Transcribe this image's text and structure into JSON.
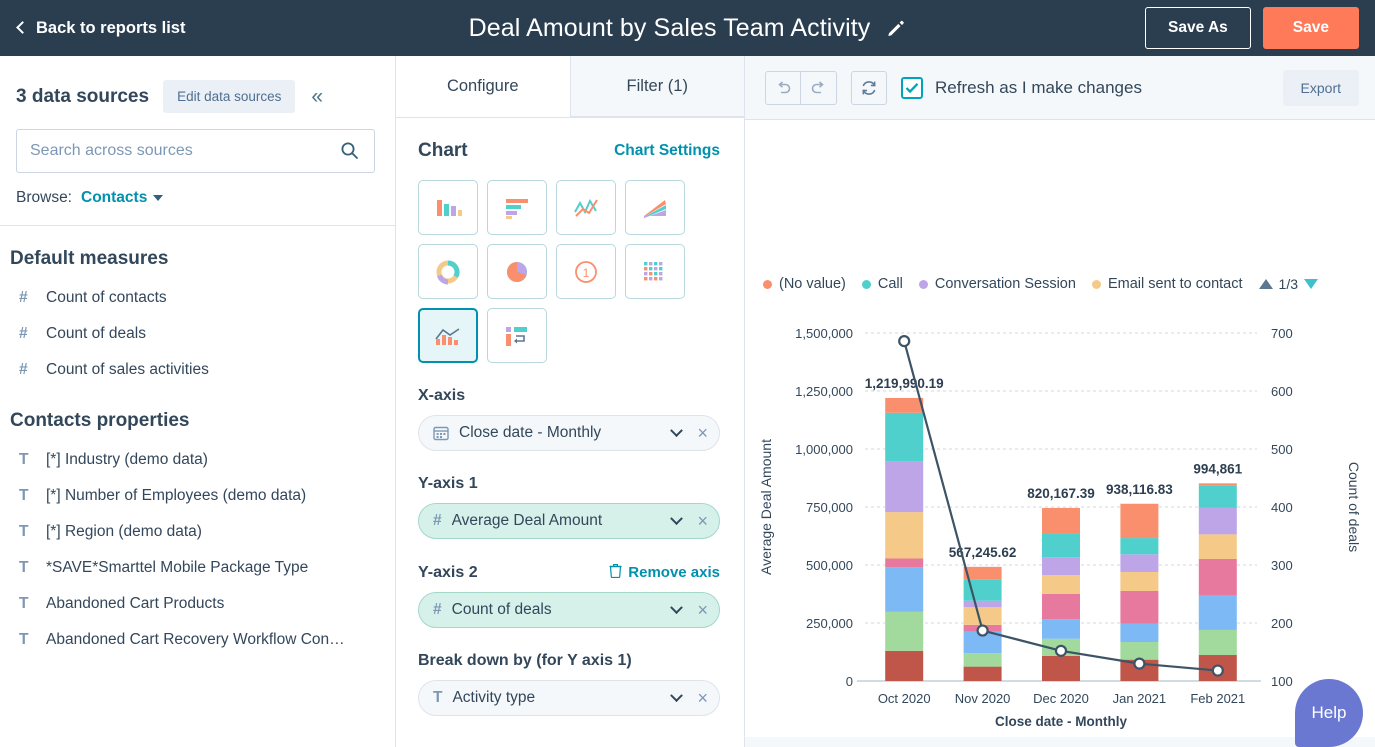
{
  "topbar": {
    "back_label": "Back to reports list",
    "title": "Deal Amount by Sales Team Activity",
    "edit_icon": "pencil-icon",
    "save_as_label": "Save As",
    "save_label": "Save",
    "save_color": "#ff7a59",
    "bg_color": "#2a3e50"
  },
  "sidebar": {
    "sources_count_label": "3 data sources",
    "edit_sources_label": "Edit data sources",
    "collapse_icon": "collapse-left-icon",
    "search_placeholder": "Search across sources",
    "search_value": "",
    "browse_label": "Browse:",
    "browse_value": "Contacts",
    "sections": [
      {
        "title": "Default measures",
        "items": [
          {
            "type": "#",
            "label": "Count of contacts"
          },
          {
            "type": "#",
            "label": "Count of deals"
          },
          {
            "type": "#",
            "label": "Count of sales activities"
          }
        ]
      },
      {
        "title": "Contacts properties",
        "items": [
          {
            "type": "T",
            "label": "[*] Industry (demo data)"
          },
          {
            "type": "T",
            "label": "[*] Number of Employees (demo data)"
          },
          {
            "type": "T",
            "label": "[*] Region (demo data)"
          },
          {
            "type": "T",
            "label": "*SAVE*Smarttel Mobile Package Type"
          },
          {
            "type": "T",
            "label": "Abandoned Cart Products"
          },
          {
            "type": "T",
            "label": "Abandoned Cart Recovery Workflow Con…"
          }
        ]
      }
    ]
  },
  "configure": {
    "tabs": [
      {
        "label": "Configure",
        "active": true
      },
      {
        "label": "Filter (1)",
        "active": false
      }
    ],
    "chart_section_title": "Chart",
    "chart_settings_label": "Chart Settings",
    "chart_types": [
      {
        "name": "vertical-bar-chart-icon",
        "selected": false
      },
      {
        "name": "horizontal-bar-chart-icon",
        "selected": false
      },
      {
        "name": "line-chart-icon",
        "selected": false
      },
      {
        "name": "area-chart-icon",
        "selected": false
      },
      {
        "name": "donut-chart-icon",
        "selected": false
      },
      {
        "name": "pie-chart-icon",
        "selected": false
      },
      {
        "name": "single-value-chart-icon",
        "selected": false
      },
      {
        "name": "pivot-table-icon",
        "selected": false
      },
      {
        "name": "combo-chart-icon",
        "selected": true
      },
      {
        "name": "funnel-chart-icon",
        "selected": false
      }
    ],
    "x_axis": {
      "label": "X-axis",
      "value": "Close date - Monthly",
      "icon": "calendar-icon"
    },
    "y_axis_1": {
      "label": "Y-axis 1",
      "value": "Average Deal Amount",
      "icon": "#"
    },
    "y_axis_2": {
      "label": "Y-axis 2",
      "value": "Count of deals",
      "icon": "#",
      "remove_label": "Remove axis",
      "remove_icon": "trash-icon"
    },
    "breakdown": {
      "label": "Break down by (for Y axis 1)",
      "value": "Activity type",
      "icon": "T"
    }
  },
  "chart_toolbar": {
    "undo_icon": "undo-icon",
    "redo_icon": "redo-icon",
    "refresh_icon": "refresh-icon",
    "refresh_checkbox_checked": true,
    "refresh_label": "Refresh as I make changes",
    "export_label": "Export"
  },
  "help": {
    "label": "Help",
    "color": "#6a78d1"
  },
  "chart_data": {
    "type": "bar",
    "title": "",
    "xlabel": "Close date - Monthly",
    "ylabel": "Average Deal Amount",
    "y2label": "Count of deals",
    "categories": [
      "Oct 2020",
      "Nov 2020",
      "Dec 2020",
      "Jan 2021",
      "Feb 2021"
    ],
    "ylim": [
      0,
      1500000
    ],
    "yticks": [
      0,
      250000,
      500000,
      750000,
      1000000,
      1250000,
      1500000
    ],
    "yticklabels": [
      "0",
      "250,000",
      "500,000",
      "750,000",
      "1,000,000",
      "1,250,000",
      "1,500,000"
    ],
    "y2lim": [
      100,
      700
    ],
    "y2ticks": [
      100,
      200,
      300,
      400,
      500,
      600,
      700
    ],
    "y2ticklabels": [
      "100",
      "200",
      "300",
      "400",
      "500",
      "600",
      "700"
    ],
    "grid": true,
    "bar_totals": [
      1219990.19,
      567245.62,
      820167.39,
      938116.83,
      994861
    ],
    "bar_total_labels": [
      "1,219,990.19",
      "567,245.62",
      "820,167.39",
      "938,116.83",
      "994,861"
    ],
    "stack_order_bottom_to_top": [
      "brick",
      "green",
      "blue",
      "pink",
      "orange",
      "purple",
      "teal",
      "salmon"
    ],
    "stack_colors": {
      "brick": "#c0564a",
      "green": "#a2d99c",
      "blue": "#7cb9f5",
      "pink": "#e8799e",
      "orange": "#f5c987",
      "purple": "#bda5e8",
      "teal": "#4fd0cd",
      "salmon": "#fa8f6e"
    },
    "stacked_series": [
      {
        "name": "brick",
        "values": [
          130000,
          62000,
          108000,
          92000,
          112000
        ]
      },
      {
        "name": "green",
        "values": [
          168000,
          58000,
          74000,
          76000,
          108000
        ]
      },
      {
        "name": "blue",
        "values": [
          192000,
          92000,
          84000,
          80000,
          148000
        ]
      },
      {
        "name": "pink",
        "values": [
          38000,
          30000,
          110000,
          140000,
          158000
        ]
      },
      {
        "name": "orange",
        "values": [
          200000,
          76000,
          80000,
          82000,
          106000
        ]
      },
      {
        "name": "purple",
        "values": [
          220000,
          28000,
          78000,
          76000,
          114000
        ]
      },
      {
        "name": "teal",
        "values": [
          208000,
          90000,
          102000,
          70000,
          96000
        ]
      },
      {
        "name": "salmon",
        "values": [
          64000,
          56000,
          110000,
          148000,
          10000
        ]
      }
    ],
    "line_series": {
      "name": "Count of deals",
      "color": "#3d5466",
      "values": [
        686,
        187,
        152,
        130,
        118
      ],
      "marker": "circle-open"
    },
    "legend": {
      "position": "top",
      "page": "1/3",
      "entries": [
        {
          "label": "(No value)",
          "color": "#fa8f6e"
        },
        {
          "label": "Call",
          "color": "#4fd0cd"
        },
        {
          "label": "Conversation Session",
          "color": "#bda5e8"
        },
        {
          "label": "Email sent to contact",
          "color": "#f5c987"
        }
      ]
    }
  }
}
